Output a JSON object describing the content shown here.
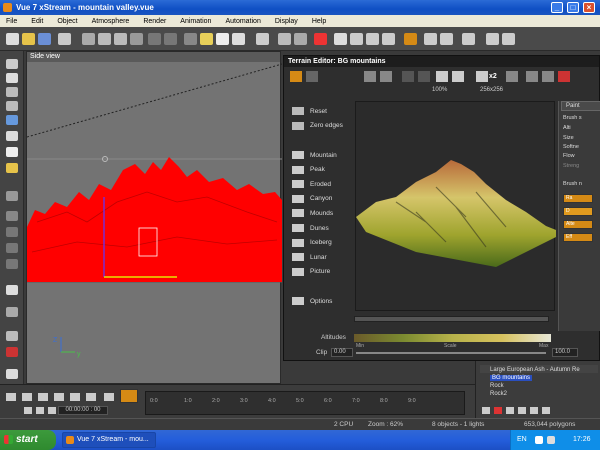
{
  "window": {
    "title": "Vue 7 xStream - mountain valley.vue",
    "controls": [
      "_",
      "□",
      "×"
    ]
  },
  "menu": [
    "File",
    "Edit",
    "Object",
    "Atmosphere",
    "Render",
    "Animation",
    "Automation",
    "Display",
    "Help"
  ],
  "viewport": {
    "label": "Side view"
  },
  "terrain_editor": {
    "title": "Terrain Editor: BG mountains",
    "zoom": "100%",
    "resolution": "256x256",
    "resolution_multiplier": "x2",
    "items": [
      "Reset",
      "Zero edges",
      "Mountain",
      "Peak",
      "Eroded",
      "Canyon",
      "Mounds",
      "Dunes",
      "Iceberg",
      "Lunar",
      "Picture",
      "Options"
    ],
    "altitudes_label": "Altitudes",
    "clip_label": "Clip",
    "clip_min": "0.00",
    "clip_max": "100.0",
    "scale_labels": {
      "min": "Min",
      "scale": "Scale",
      "max": "Max"
    },
    "paint_tab": "Paint",
    "brush_labels": [
      "Brush s",
      "Alti",
      "Size",
      "Softne",
      "Flow",
      "Streng",
      "Brush n"
    ],
    "brush_buttons": [
      "Ra",
      "D",
      "Alte",
      "Eff"
    ]
  },
  "timeline": {
    "time": "00:00:00 : 00",
    "ticks": [
      "0:0",
      "1:0",
      "2:0",
      "3:0",
      "4:0",
      "5:0",
      "6:0",
      "7:0",
      "8:0",
      "9:0"
    ]
  },
  "scene_list": [
    "Large European Ash - Autumn Re",
    "BG mountains",
    "Rock",
    "Rock2"
  ],
  "status": {
    "cpu": "2 CPU",
    "zoom": "Zoom : 62%",
    "objects": "8 objects - 1 lights",
    "polygons": "653,044 polygons"
  },
  "taskbar": {
    "start": "start",
    "task": "Vue 7 xStream - mou...",
    "lang": "EN",
    "time": "17:26"
  },
  "colors": {
    "accent_orange": "#d58a15",
    "terrain_red": "#ff0000",
    "xp_blue": "#245edb"
  }
}
